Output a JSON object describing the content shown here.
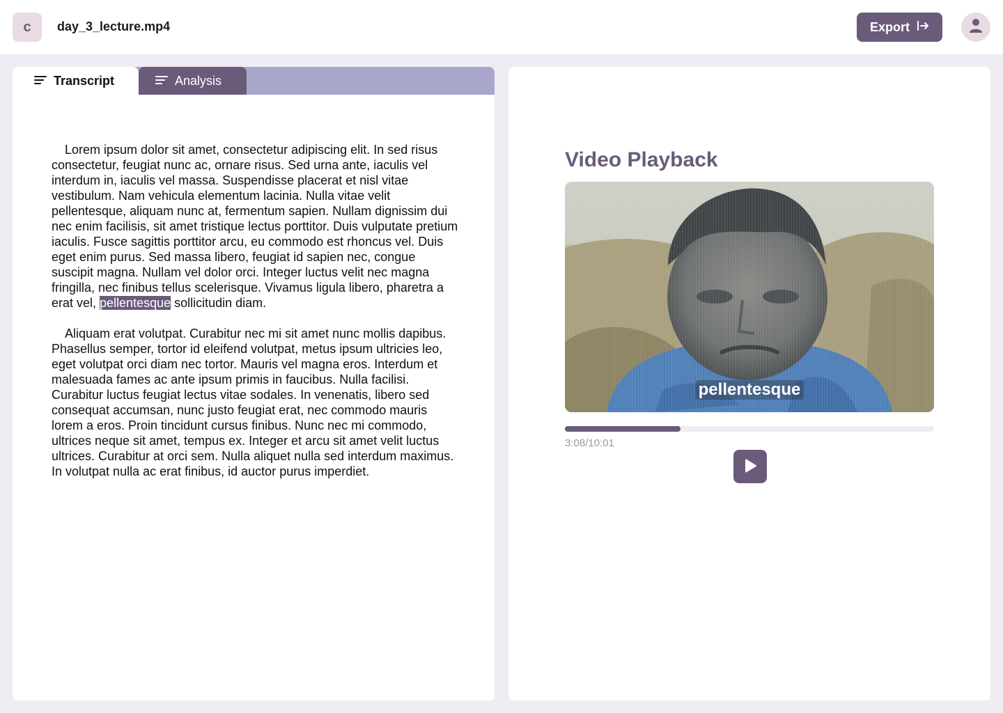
{
  "header": {
    "logo_letter": "c",
    "filename": "day_3_lecture.mp4",
    "export_label": "Export"
  },
  "tabs": [
    {
      "label": "Transcript",
      "active": true
    },
    {
      "label": "Analysis",
      "active": false
    }
  ],
  "transcript": {
    "p1_before": "Lorem ipsum dolor sit amet, consectetur adipiscing elit. In sed risus consectetur, feugiat nunc ac, ornare risus. Sed urna ante, iaculis vel interdum in, iaculis vel massa. Suspendisse placerat et nisl vitae vestibulum. Nam vehicula elementum lacinia. Nulla vitae velit pellentesque, aliquam nunc at, fermentum sapien. Nullam dignissim dui nec enim facilisis, sit amet tristique lectus porttitor. Duis vulputate pretium iaculis. Fusce sagittis porttitor arcu, eu commodo est rhoncus vel. Duis eget enim purus. Sed massa libero, feugiat id sapien nec, congue suscipit magna. Nullam vel dolor orci. Integer luctus velit nec magna fringilla, nec finibus tellus scelerisque. Vivamus ligula libero, pharetra a erat vel, ",
    "p1_highlight": "pellentesque",
    "p1_after": " sollicitudin diam.",
    "p2": "Aliquam erat volutpat. Curabitur nec mi sit amet nunc mollis dapibus. Phasellus semper, tortor id eleifend volutpat, metus ipsum ultricies leo, eget volutpat orci diam nec tortor. Mauris vel magna eros. Interdum et malesuada fames ac ante ipsum primis in faucibus. Nulla facilisi. Curabitur luctus feugiat lectus vitae sodales. In venenatis, libero sed consequat accumsan, nunc justo feugiat erat, nec commodo mauris lorem a eros. Proin tincidunt cursus finibus. Nunc nec mi commodo, ultrices neque sit amet, tempus ex. Integer et arcu sit amet velit luctus ultrices. Curabitur at orci sem. Nulla aliquet nulla sed interdum maximus. In volutpat nulla ac erat finibus, id auctor purus imperdiet."
  },
  "video": {
    "title": "Video Playback",
    "subtitle": "pellentesque",
    "time": "3:08/10:01",
    "progress_fraction": 0.313
  },
  "icons": {
    "export": "export-arrow-icon",
    "user": "user-icon",
    "menu": "lines-icon",
    "play": "play-icon"
  },
  "colors": {
    "accent": "#6a5b7b",
    "tab_strip": "#a8a6cb",
    "background": "#efecf3",
    "soft_pink": "#e9dbe3"
  }
}
